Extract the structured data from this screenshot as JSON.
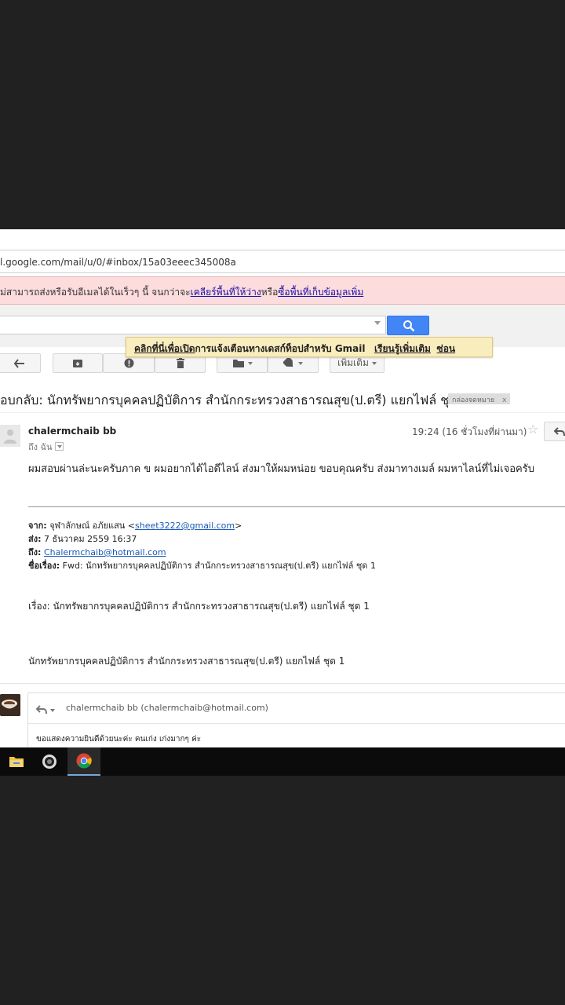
{
  "browser": {
    "url": "l.google.com/mail/u/0/#inbox/15a03eeec345008a"
  },
  "alert": {
    "prefix": "ม่สามารถส่งหรือรับอีเมลได้ในเร็วๆ นี้ จนกว่าจะ",
    "link1": "เคลียร์พื้นที่ให้ว่าง",
    "middle": "หรือ",
    "link2": "ซื้อพื้นที่เก็บข้อมูลเพิ่ม"
  },
  "tooltip": {
    "link1": "คลิกที่นี่เพื่อเปิด",
    "text": "การแจ้งเตือนทางเดสก์ท็อปสำหรับ Gmail",
    "learn_more": "เรียนรู้เพิ่มเติม",
    "hide": "ซ่อน"
  },
  "toolbar": {
    "more_label": "เพิ่มเติม"
  },
  "message": {
    "subject": "อบกลับ: นักทรัพยากรบุคคลปฏิบัติการ สำนักกระทรวงสาธารณสุข(ป.ตรี) แยกไฟล์ ชุด 1",
    "label": "กล่องจดหมาย",
    "label_close": "x",
    "sender": "chalermchaib bb",
    "to_me": "ถึง ฉัน",
    "time": "19:24 (16 ชั่วโมงที่ผ่านมา)",
    "star": "☆",
    "body": "ผมสอบผ่านล่ะนะครับภาค ข ผมอยากได้ไอดีไลน์ ส่งมาให้ผมหน่อย ขอบคุณครับ ส่งมาทางเมล์ ผมหาไลน์ที่ไม่เจอครับ"
  },
  "quoted": {
    "from_label": "จาก:",
    "from_name": "จุฬาลักษณ์ อภัยแสน <",
    "from_email": "sheet3222@gmail.com",
    "from_close": ">",
    "sent_label": "ส่ง:",
    "sent_value": "7 ธันวาคม 2559 16:37",
    "to_label": "ถึง:",
    "to_email": "Chalermchaib@hotmail.com",
    "subject_label": "ชื่อเรื่อง:",
    "subject_value": "Fwd: นักทรัพยากรบุคคลปฏิบัติการ สำนักกระทรวงสาธารณสุข(ป.ตรี) แยกไฟล์ ชุด 1",
    "subject_line": "เรื่อง: นักทรัพยากรบุคคลปฏิบัติการ สำนักกระทรวงสาธารณสุข(ป.ตรี) แยกไฟล์ ชุด 1",
    "body_line": "นักทรัพยากรบุคคลปฏิบัติการ สำนักกระทรวงสาธารณสุข(ป.ตรี) แยกไฟล์ ชุด 1"
  },
  "reply": {
    "to": "chalermchaib bb (chalermchaib@hotmail.com)",
    "body": "ขอแสดงความยินดีด้วยนะค่ะ คนเก่ง เก่งมากๆ ค่ะ"
  },
  "colors": {
    "search_button": "#4285f4",
    "alert_bg": "#fcdcdc",
    "tooltip_bg": "#f9edbe"
  }
}
